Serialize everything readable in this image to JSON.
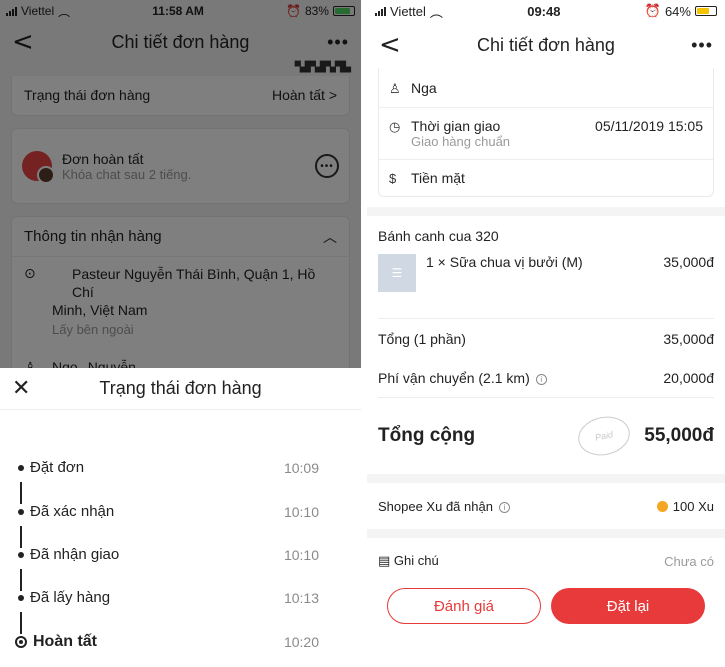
{
  "left": {
    "status": {
      "carrier": "Viettel",
      "time": "11:58 AM",
      "battery": "83%"
    },
    "nav": {
      "title": "Chi tiết đơn hàng",
      "back": "<",
      "more": "•••"
    },
    "order_status_row": {
      "label": "Trạng thái đơn hàng",
      "value": "Hoàn tất",
      "chevron": ">"
    },
    "chat": {
      "title": "Đơn hoàn tất",
      "subtitle": "Khóa chat sau 2 tiếng."
    },
    "receive_info": {
      "title": "Thông tin nhận hàng",
      "address_line1": "Pasteur Nguyễn Thái Bình, Quận 1, Hồ Chí",
      "address_line2": "Minh, Việt Nam",
      "pickup": "Lấy bên ngoài",
      "name_first": "Ngọ",
      "name_last": "Nguyễn"
    },
    "sheet": {
      "title": "Trạng thái đơn hàng",
      "steps": [
        {
          "label": "Đặt đơn",
          "time": "10:09"
        },
        {
          "label": "Đã xác nhận",
          "time": "10:10"
        },
        {
          "label": "Đã nhận giao",
          "time": "10:10"
        },
        {
          "label": "Đã lấy hàng",
          "time": "10:13"
        },
        {
          "label": "Hoàn tất",
          "time": "10:20"
        }
      ]
    }
  },
  "right": {
    "status": {
      "carrier": "Viettel",
      "time": "09:48",
      "battery": "64%"
    },
    "nav": {
      "title": "Chi tiết đơn hàng",
      "back": "<",
      "more": "•••"
    },
    "delivery": {
      "name": "Nga",
      "time_label": "Thời gian giao",
      "time_value": "05/11/2019 15:05",
      "time_sub": "Giao hàng chuẩn",
      "payment": "Tiền mặt"
    },
    "store": "Bánh canh cua 320",
    "item": {
      "name": "1 × Sữa chua vị bưởi (M)",
      "price": "35,000đ"
    },
    "subtotal": {
      "label": "Tổng (1 phần)",
      "value": "35,000đ"
    },
    "shipping": {
      "label": "Phí vận chuyển (2.1 km)",
      "value": "20,000đ"
    },
    "total": {
      "label": "Tổng cộng",
      "value": "55,000đ",
      "stamp": "Paid"
    },
    "xu": {
      "label": "Shopee Xu đã nhận",
      "value": "100 Xu"
    },
    "note": {
      "label": "Ghi chú",
      "value": "Chưa có"
    },
    "buttons": {
      "rate": "Đánh giá",
      "reorder": "Đặt lại"
    },
    "colors": {
      "accent": "#e8393b",
      "coin": "#f5a623"
    }
  }
}
